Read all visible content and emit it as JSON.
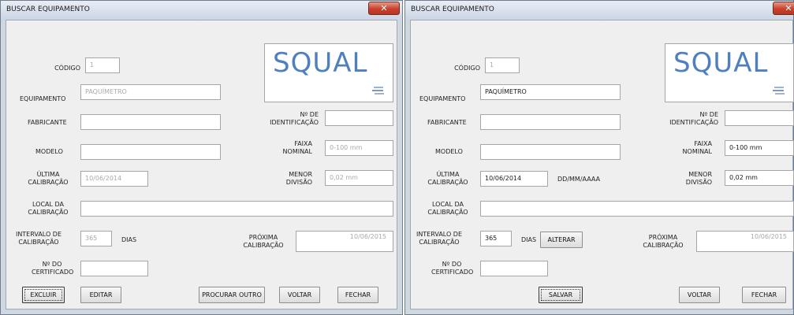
{
  "colors": {
    "logo": "#4f7fbf",
    "close": "#c9412c"
  },
  "windows": [
    {
      "title": "BUSCAR EQUIPAMENTO",
      "labels": {
        "codigo": "CÓDIGO",
        "equipamento": "EQUIPAMENTO",
        "fabricante": "FABRICANTE",
        "modelo": "MODELO",
        "ultima_calibracao": "ÚLTIMA CALIBRAÇÃO",
        "local_calibracao": "LOCAL DA CALIBRAÇÃO",
        "intervalo_calibracao": "INTERVALO DE CALIBRAÇÃO",
        "dias": "DIAS",
        "certificado": "Nº DO CERTIFICADO",
        "identificacao": "Nº DE IDENTIFICAÇÃO",
        "faixa_nominal": "FAIXA NOMINAL",
        "menor_divisao": "MENOR DIVISÃO",
        "proxima_calibracao": "PRÓXIMA CALIBRAÇÃO"
      },
      "fields": {
        "codigo": "1",
        "equipamento": "PAQUÍMETRO",
        "fabricante": "",
        "modelo": "",
        "ultima_calibracao": "10/06/2014",
        "local_calibracao": "",
        "intervalo": "365",
        "certificado": "",
        "identificacao": "",
        "faixa_nominal": "0-100 mm",
        "menor_divisao": "0,02 mm",
        "proxima_calibracao": "10/06/2015"
      },
      "logo_text": "SQUAL",
      "buttons": {
        "excluir": "EXCLUIR",
        "editar": "EDITAR",
        "procurar_outro": "PROCURAR OUTRO",
        "voltar": "VOLTAR",
        "fechar": "FECHAR"
      }
    },
    {
      "title": "BUSCAR EQUIPAMENTO",
      "labels": {
        "codigo": "CÓDIGO",
        "equipamento": "EQUIPAMENTO",
        "fabricante": "FABRICANTE",
        "modelo": "MODELO",
        "ultima_calibracao": "ÚLTIMA CALIBRAÇÃO",
        "date_hint": "DD/MM/AAAA",
        "local_calibracao": "LOCAL DA CALIBRAÇÃO",
        "intervalo_calibracao": "INTERVALO DE CALIBRAÇÃO",
        "dias": "DIAS",
        "certificado": "Nº DO CERTIFICADO",
        "identificacao": "Nº DE IDENTIFICAÇÃO",
        "faixa_nominal": "FAIXA NOMINAL",
        "menor_divisao": "MENOR DIVISÃO",
        "proxima_calibracao": "PRÓXIMA CALIBRAÇÃO"
      },
      "fields": {
        "codigo": "1",
        "equipamento": "PAQUÍMETRO",
        "fabricante": "",
        "modelo": "",
        "ultima_calibracao": "10/06/2014",
        "local_calibracao": "",
        "intervalo": "365",
        "certificado": "",
        "identificacao": "",
        "faixa_nominal": "0-100 mm",
        "menor_divisao": "0,02 mm",
        "proxima_calibracao": "10/06/2015"
      },
      "logo_text": "SQUAL",
      "buttons": {
        "alterar": "ALTERAR",
        "salvar": "SALVAR",
        "voltar": "VOLTAR",
        "fechar": "FECHAR"
      }
    }
  ]
}
